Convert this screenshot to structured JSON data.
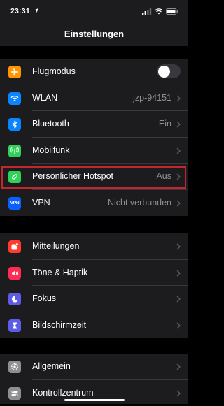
{
  "status_bar": {
    "time": "23:31"
  },
  "nav": {
    "title": "Einstellungen"
  },
  "colors": {
    "airplane": "#ff9500",
    "wifi": "#0a84ff",
    "bluetooth": "#0a84ff",
    "cellular": "#30d158",
    "hotspot": "#30d158",
    "vpn": "#0a60ff",
    "notifications": "#ff3b30",
    "sounds": "#ff2d55",
    "focus": "#5e5ce6",
    "screentime": "#5e5ce6",
    "general": "#8e8e93",
    "control": "#8e8e93",
    "highlight_border": "#c1272d"
  },
  "group1": {
    "airplane": {
      "label": "Flugmodus",
      "value": ""
    },
    "wifi": {
      "label": "WLAN",
      "value": "jzp-94151"
    },
    "bluetooth": {
      "label": "Bluetooth",
      "value": "Ein"
    },
    "cellular": {
      "label": "Mobilfunk",
      "value": ""
    },
    "hotspot": {
      "label": "Persönlicher Hotspot",
      "value": "Aus"
    },
    "vpn": {
      "label": "VPN",
      "value": "Nicht verbunden",
      "icon_text": "VPN"
    }
  },
  "group2": {
    "notifications": {
      "label": "Mitteilungen"
    },
    "sounds": {
      "label": "Töne & Haptik"
    },
    "focus": {
      "label": "Fokus"
    },
    "screentime": {
      "label": "Bildschirmzeit"
    }
  },
  "group3": {
    "general": {
      "label": "Allgemein"
    },
    "control": {
      "label": "Kontrollzentrum"
    }
  },
  "icons": {
    "airplane": "airplane-icon",
    "wifi": "wifi-icon",
    "bluetooth": "bluetooth-icon",
    "cellular": "cellular-antenna-icon",
    "hotspot": "hotspot-link-icon",
    "vpn": "vpn-icon",
    "notifications": "notifications-icon",
    "sounds": "speaker-icon",
    "focus": "moon-icon",
    "screentime": "hourglass-icon",
    "general": "gear-icon",
    "control": "toggles-icon"
  },
  "toggles": {
    "airplane_mode_on": false
  }
}
